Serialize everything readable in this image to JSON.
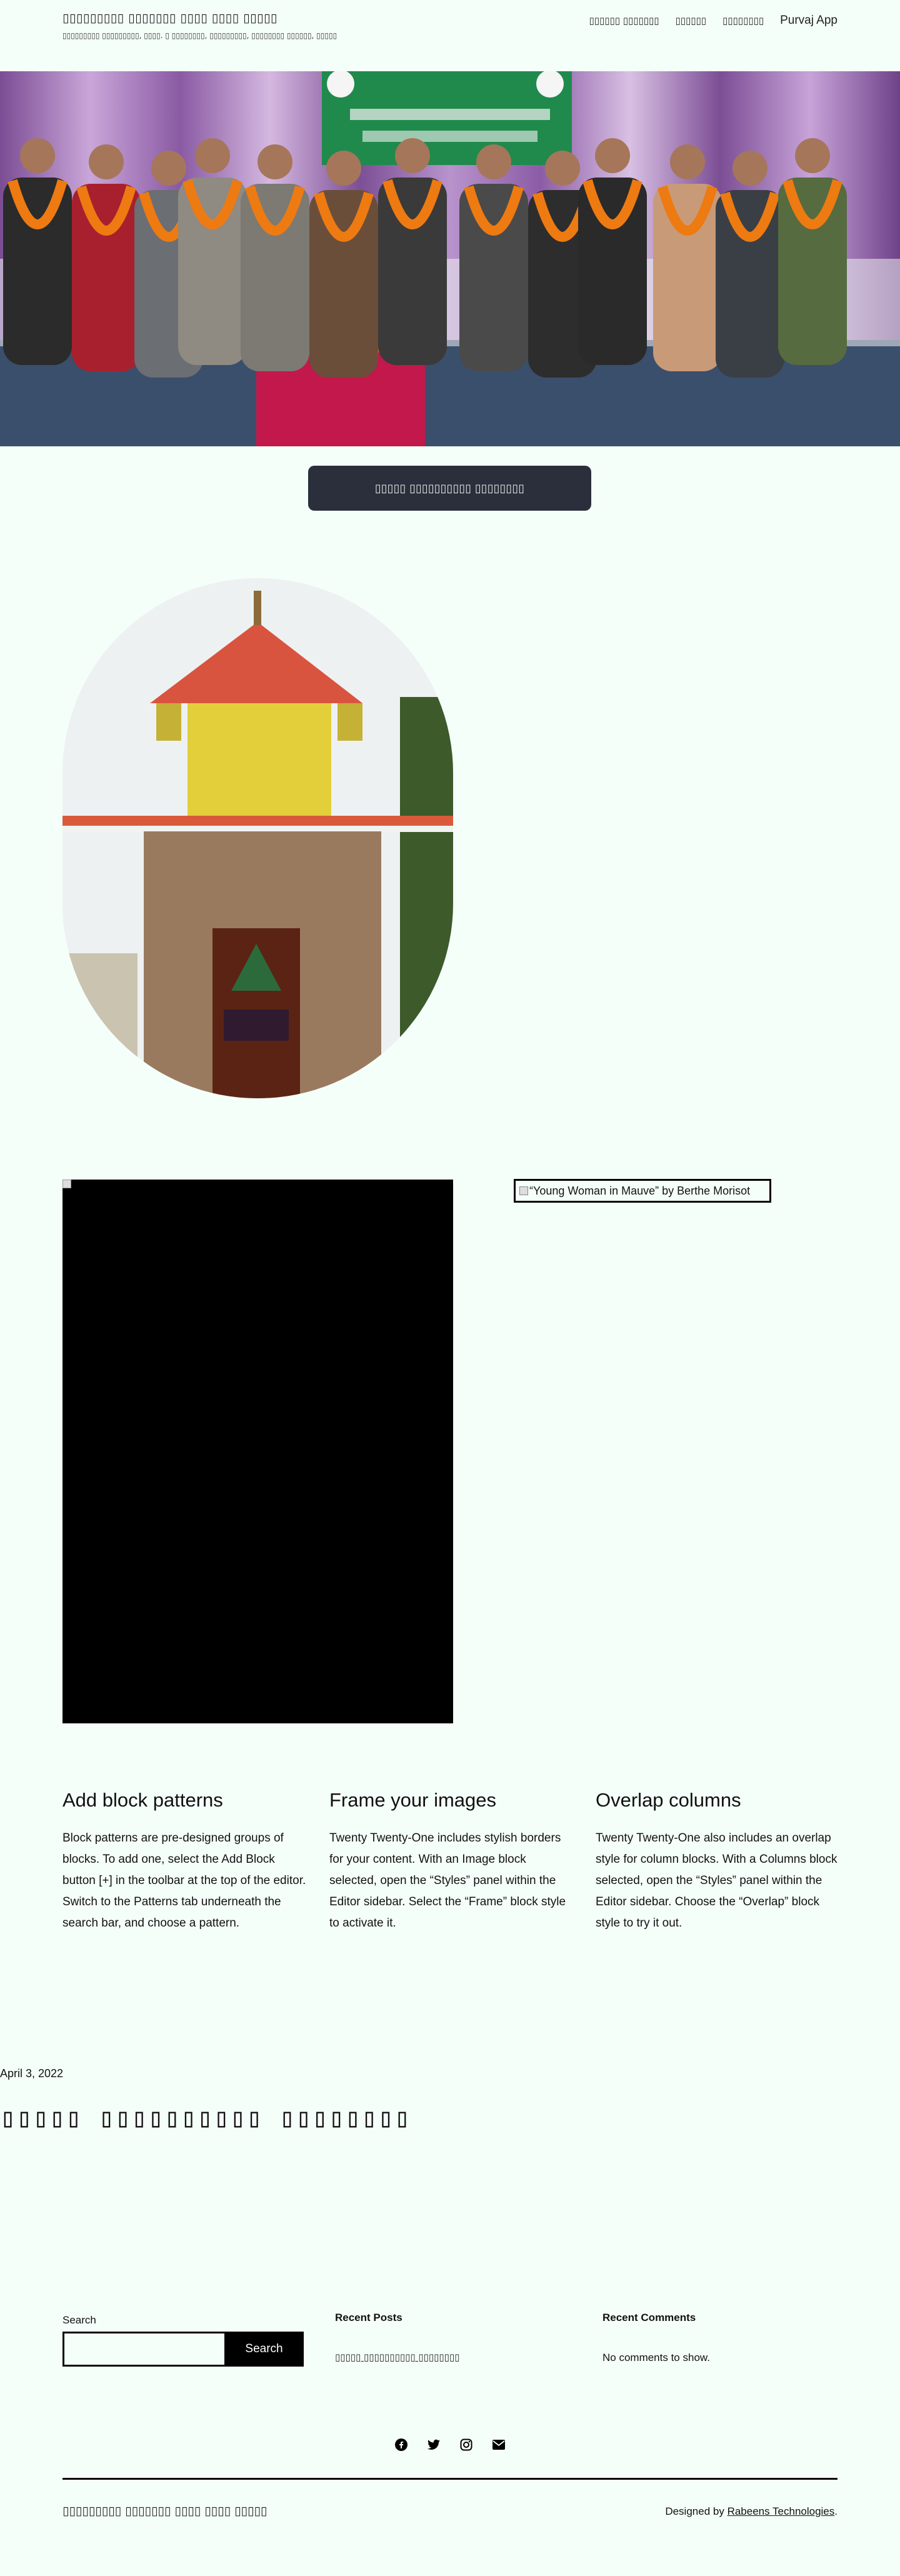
{
  "header": {
    "site_title": "▯▯▯▯▯▯▯▯▯ ▯▯▯▯▯▯▯ ▯▯▯▯ ▯▯▯▯ ▯▯▯▯▯",
    "tagline": "▯▯▯▯▯▯▯▯▯ ▯▯▯▯▯▯▯▯▯, ▯▯▯▯. ▯ ▯▯▯▯▯▯▯▯, ▯▯▯▯▯▯▯▯▯, ▯▯▯▯▯▯▯▯ ▯▯▯▯▯▯, ▯▯▯▯▯",
    "nav": [
      "▯▯▯▯▯▯ ▯▯▯▯▯▯▯",
      "▯▯▯▯▯▯",
      "▯▯▯▯▯▯▯▯",
      "Purvaj App"
    ]
  },
  "cta": {
    "label": "▯▯▯▯▯ ▯▯▯▯▯▯▯▯▯▯ ▯▯▯▯▯▯▯▯"
  },
  "gallery": {
    "morisot_alt": "“Young Woman in Mauve” by Berthe Morisot"
  },
  "columns": [
    {
      "title": "Add block patterns",
      "body": "Block patterns are pre-designed groups of blocks. To add one, select the Add Block button [+] in the toolbar at the top of the editor. Switch to the Patterns tab underneath the search bar, and choose a pattern."
    },
    {
      "title": "Frame your images",
      "body": "Twenty Twenty-One includes stylish borders for your content. With an Image block selected, open the “Styles” panel within the Editor sidebar. Select the “Frame” block style to activate it."
    },
    {
      "title": "Overlap columns",
      "body": "Twenty Twenty-One also includes an overlap style for column blocks. With a Columns block selected, open the “Styles” panel within the Editor sidebar. Choose the “Overlap” block style to try it out."
    }
  ],
  "post": {
    "date": "April 3, 2022",
    "title": "▯▯▯▯▯ ▯▯▯▯▯▯▯▯▯▯ ▯▯▯▯▯▯▯▯"
  },
  "widgets": {
    "search_label": "Search",
    "search_button": "Search",
    "search_value": "",
    "recent_posts_title": "Recent Posts",
    "recent_post": "▯▯▯▯▯ ▯▯▯▯▯▯▯▯▯▯ ▯▯▯▯▯▯▯▯",
    "recent_comments_title": "Recent Comments",
    "no_comments": "No comments to show."
  },
  "social": [
    "facebook-icon",
    "twitter-icon",
    "instagram-icon",
    "mail-icon"
  ],
  "footer": {
    "site_title": "▯▯▯▯▯▯▯▯▯ ▯▯▯▯▯▯▯ ▯▯▯▯ ▯▯▯▯ ▯▯▯▯▯",
    "credit_prefix": "Designed by ",
    "credit_link": "Rabeens Technologies",
    "credit_suffix": "."
  },
  "colors": {
    "background": "#f5fffa",
    "button_dark": "#2a2f3b",
    "text": "#111111"
  }
}
